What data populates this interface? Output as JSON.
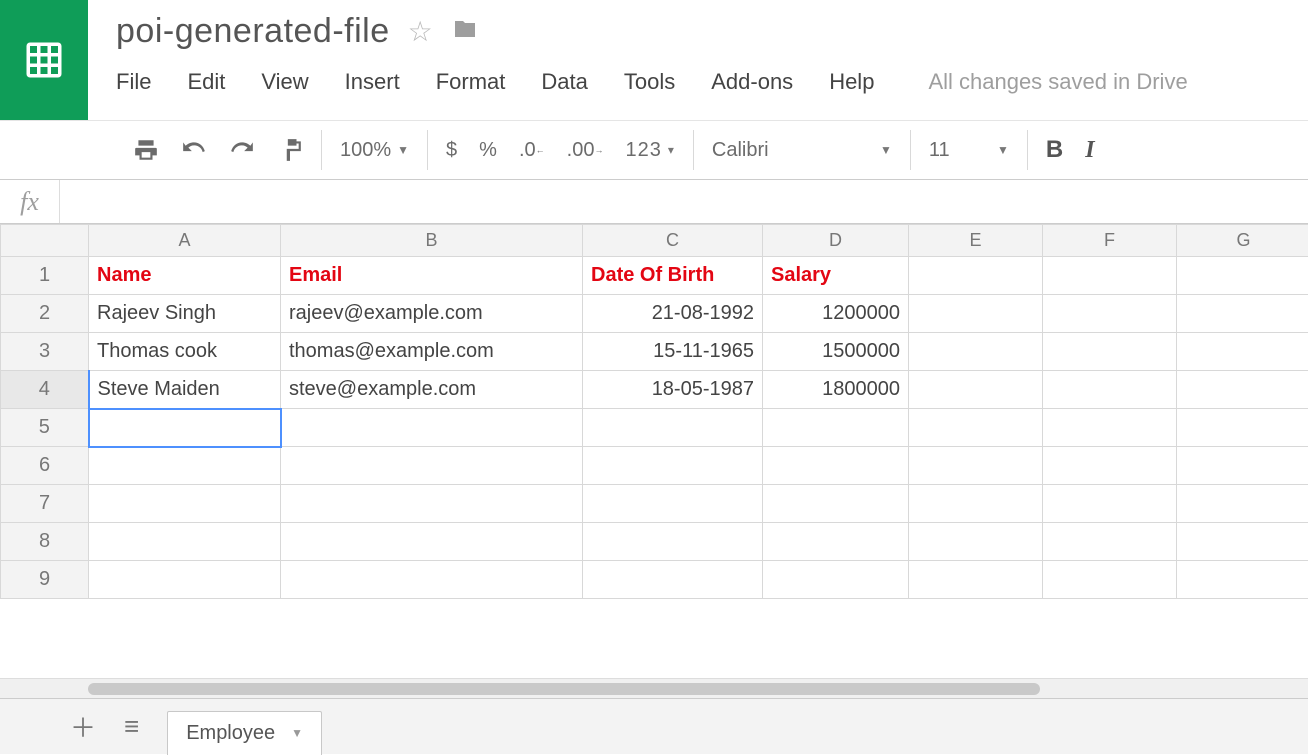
{
  "doc": {
    "title": "poi-generated-file",
    "save_status": "All changes saved in Drive"
  },
  "menus": {
    "file": "File",
    "edit": "Edit",
    "view": "View",
    "insert": "Insert",
    "format": "Format",
    "data": "Data",
    "tools": "Tools",
    "addons": "Add-ons",
    "help": "Help"
  },
  "toolbar": {
    "zoom": "100%",
    "currency": "$",
    "percent": "%",
    "dec_dec": ".0",
    "dec_inc": ".00",
    "numfmt": "123",
    "font": "Calibri",
    "font_size": "11",
    "bold": "B",
    "italic": "I"
  },
  "formula_bar": {
    "label": "fx",
    "value": ""
  },
  "columns": [
    "A",
    "B",
    "C",
    "D",
    "E",
    "F",
    "G"
  ],
  "row_numbers": [
    1,
    2,
    3,
    4,
    5,
    6,
    7,
    8,
    9
  ],
  "sheet": {
    "headers": [
      "Name",
      "Email",
      "Date Of Birth",
      "Salary"
    ],
    "rows": [
      {
        "name": "Rajeev Singh",
        "email": "rajeev@example.com",
        "dob": "21-08-1992",
        "salary": "1200000"
      },
      {
        "name": "Thomas cook",
        "email": "thomas@example.com",
        "dob": "15-11-1965",
        "salary": "1500000"
      },
      {
        "name": "Steve Maiden",
        "email": "steve@example.com",
        "dob": "18-05-1987",
        "salary": "1800000"
      }
    ]
  },
  "tabs": {
    "active": "Employee"
  }
}
